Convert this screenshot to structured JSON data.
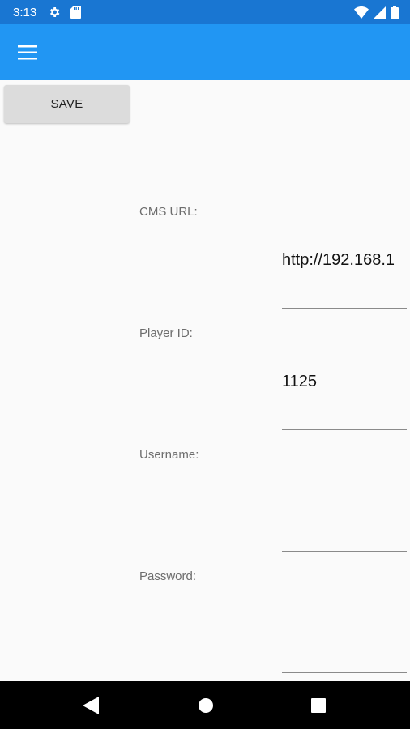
{
  "status_bar": {
    "time": "3:13",
    "icons_left": [
      "settings-icon",
      "sd-card-icon"
    ],
    "icons_right": [
      "wifi-icon",
      "signal-icon",
      "battery-icon"
    ]
  },
  "app_bar": {
    "menu_icon": "hamburger-menu-icon",
    "color": "#2196f3"
  },
  "toolbar": {
    "save_label": "SAVE"
  },
  "form": {
    "cms_url": {
      "label": "CMS URL:",
      "value": "http://192.168.1"
    },
    "player_id": {
      "label": "Player ID:",
      "value": "1125"
    },
    "username": {
      "label": "Username:",
      "value": ""
    },
    "password": {
      "label": "Password:",
      "value": ""
    }
  },
  "nav_bar": {
    "buttons": [
      "back-icon",
      "home-icon",
      "recents-icon"
    ]
  },
  "colors": {
    "status_bar": "#1976d2",
    "app_bar": "#2196f3",
    "background": "#fafafa",
    "nav_bar": "#000000"
  }
}
